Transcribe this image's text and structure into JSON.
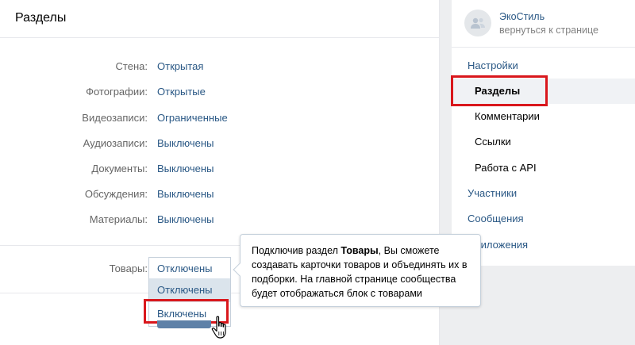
{
  "main": {
    "title": "Разделы",
    "rows": [
      {
        "label": "Стена:",
        "value": "Открытая"
      },
      {
        "label": "Фотографии:",
        "value": "Открытые"
      },
      {
        "label": "Видеозаписи:",
        "value": "Ограниченные"
      },
      {
        "label": "Аудиозаписи:",
        "value": "Выключены"
      },
      {
        "label": "Документы:",
        "value": "Выключены"
      },
      {
        "label": "Обсуждения:",
        "value": "Выключены"
      },
      {
        "label": "Материалы:",
        "value": "Выключены"
      }
    ],
    "goods": {
      "label": "Товары:",
      "current": "Отключены",
      "options": [
        "Отключены",
        "Включены"
      ]
    }
  },
  "tooltip": {
    "before": "Подключив раздел ",
    "bold": "Товары",
    "after": ", Вы сможете создавать карточки товаров и объединять их в подборки. На главной странице сообщества будет отображаться блок с товарами"
  },
  "sidebar": {
    "group_name": "ЭкоСтиль",
    "back_link": "вернуться к странице",
    "nav": [
      {
        "label": "Настройки"
      },
      {
        "label": "Разделы"
      },
      {
        "label": "Комментарии"
      },
      {
        "label": "Ссылки"
      },
      {
        "label": "Работа с API"
      },
      {
        "label": "Участники"
      },
      {
        "label": "Сообщения"
      },
      {
        "label": "Приложения"
      }
    ]
  },
  "colors": {
    "link": "#2a5885",
    "highlight": "#d9171c",
    "background": "#edeef0"
  }
}
